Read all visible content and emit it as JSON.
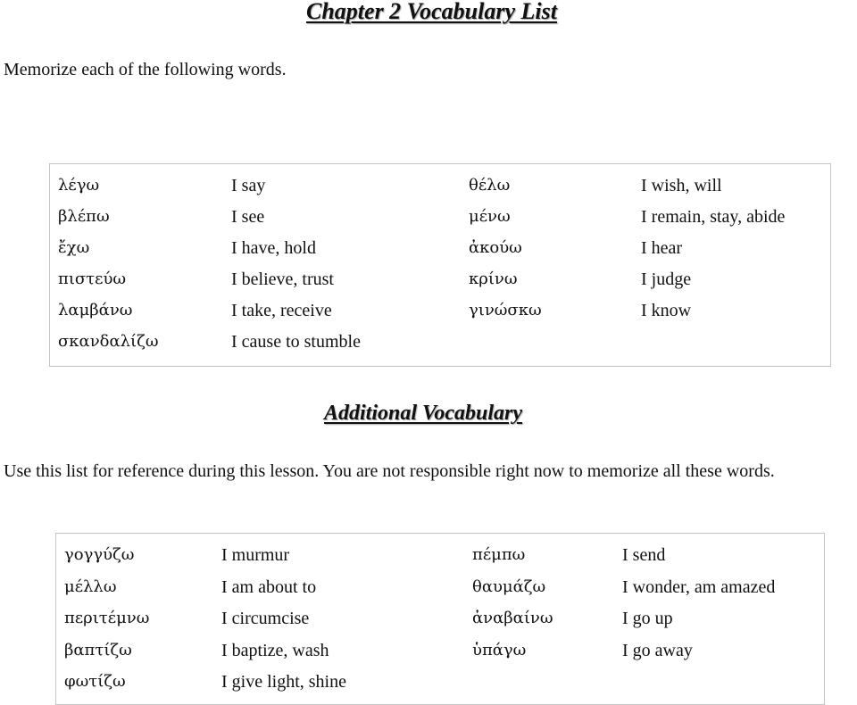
{
  "document": {
    "title": "Chapter 2 Vocabulary List",
    "instructions": "Memorize each of the following words.",
    "core_vocabulary": {
      "left_column": [
        {
          "greek": "λέγω",
          "english": "I say"
        },
        {
          "greek": "βλέπω",
          "english": "I see"
        },
        {
          "greek": "ἔχω",
          "english": "I have, hold"
        },
        {
          "greek": "πιστεύω",
          "english": "I believe, trust"
        },
        {
          "greek": "λαμβάνω",
          "english": "I take, receive"
        },
        {
          "greek": "σκανδαλίζω",
          "english": "I cause to stumble"
        }
      ],
      "right_column": [
        {
          "greek": "θέλω",
          "english": "I wish, will"
        },
        {
          "greek": "μένω",
          "english": "I remain, stay, abide"
        },
        {
          "greek": "ἀκούω",
          "english": "I hear"
        },
        {
          "greek": "κρίνω",
          "english": "I judge"
        },
        {
          "greek": "γινώσκω",
          "english": "I know"
        }
      ]
    },
    "additional_heading": "Additional Vocabulary",
    "additional_instructions": "Use this list for reference during this lesson.  You are not responsible right now to memorize all these words.",
    "additional_vocabulary": {
      "left_column": [
        {
          "greek": "γογγύζω",
          "english": "I murmur"
        },
        {
          "greek": "μέλλω",
          "english": "I am about to"
        },
        {
          "greek": "περιτέμνω",
          "english": "I circumcise"
        },
        {
          "greek": "βαπτίζω",
          "english": "I baptize, wash"
        },
        {
          "greek": "φωτίζω",
          "english": "I give light, shine"
        }
      ],
      "right_column": [
        {
          "greek": "πέμπω",
          "english": "I send"
        },
        {
          "greek": "θαυμάζω",
          "english": "I wonder, am amazed"
        },
        {
          "greek": "ἀναβαίνω",
          "english": "I go up"
        },
        {
          "greek": "ὑπάγω",
          "english": "I go away"
        }
      ]
    }
  }
}
